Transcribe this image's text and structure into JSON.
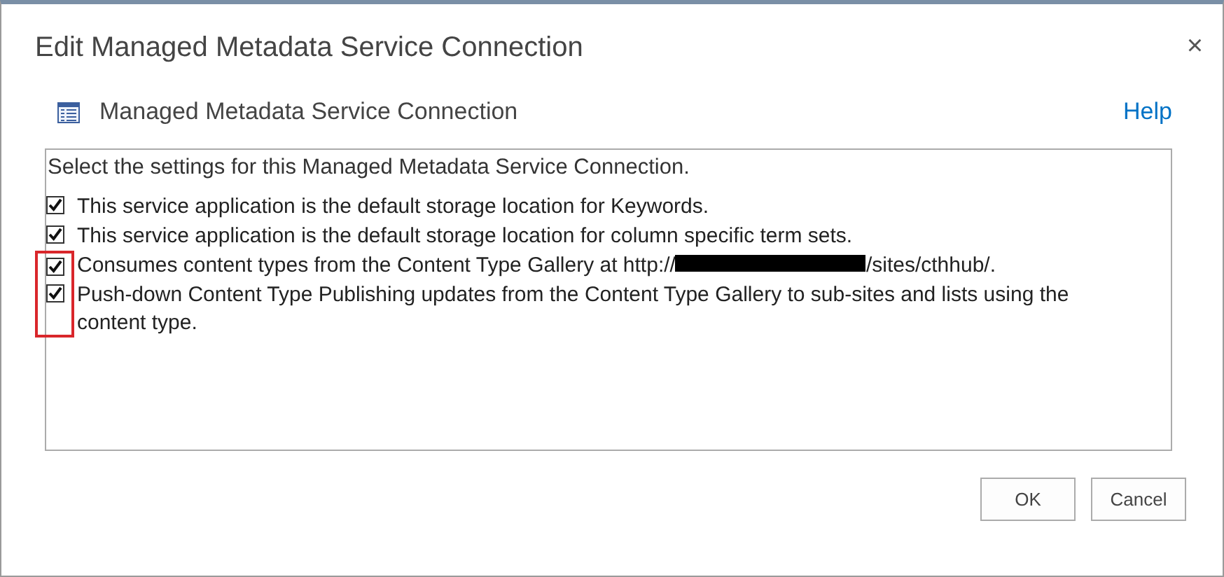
{
  "window": {
    "title": "Edit Managed Metadata Service Connection",
    "close": "×"
  },
  "header": {
    "title": "Managed Metadata Service Connection",
    "help": "Help"
  },
  "settings": {
    "intro": "Select the settings for this Managed Metadata Service Connection.",
    "options": [
      {
        "text": "This service application is the default storage location for Keywords.",
        "checked": true,
        "highlighted": false
      },
      {
        "text": "This service application is the default storage location for column specific term sets.",
        "checked": true,
        "highlighted": false
      },
      {
        "text": "Consumes content types from the Content Type Gallery at http://",
        "redacted": true,
        "text_after": "/sites/cthhub/.",
        "checked": true,
        "highlighted": true
      },
      {
        "text": "Push-down Content Type Publishing updates from the Content Type Gallery to sub-sites and lists using the content type.",
        "checked": true,
        "highlighted": true
      }
    ]
  },
  "buttons": [
    {
      "label": "OK"
    },
    {
      "label": "Cancel"
    }
  ]
}
